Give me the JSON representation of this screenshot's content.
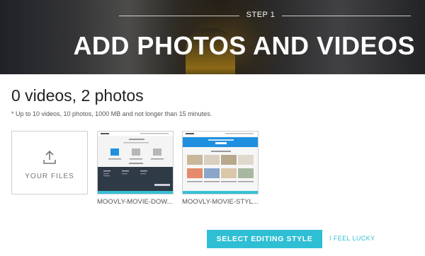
{
  "header": {
    "step_label": "STEP 1",
    "title": "ADD PHOTOS AND VIDEOS"
  },
  "summary": {
    "counts": "0 videos, 2 photos",
    "note": "* Up to 10 videos, 10 photos, 1000 MB and not longer than 15 minutes."
  },
  "upload": {
    "label": "YOUR FILES",
    "icon": "upload-icon"
  },
  "media": [
    {
      "filename": "MOOVLY-MOVIE-DOW..."
    },
    {
      "filename": "MOOVLY-MOVIE-STYL..."
    }
  ],
  "actions": {
    "primary_label": "SELECT EDITING STYLE",
    "secondary_label": "I FEEL LUCKY"
  },
  "colors": {
    "accent": "#2fbfd4",
    "thumb_bar": "#35c0d6"
  }
}
